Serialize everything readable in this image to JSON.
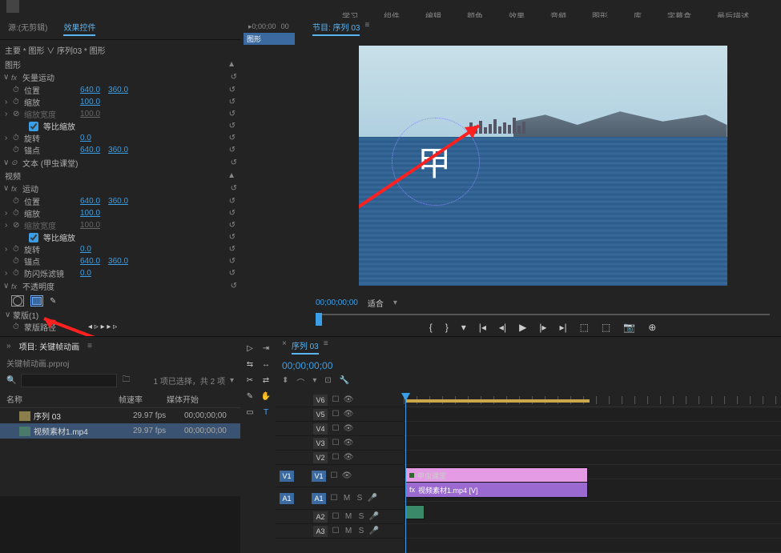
{
  "top_source": "源:(无剪辑)",
  "top_fx": "效果控件",
  "top_menu": [
    "学习",
    "组件",
    "编辑",
    "颜色",
    "效果",
    "音频",
    "图形",
    "库",
    "字幕盒",
    "最后描述"
  ],
  "breadcrumb": "主要 * 图形 ∨ 序列03 * 图形",
  "section_graphic": "图形",
  "seq_time_a": "0;00;00",
  "seq_time_b": "00",
  "seq_clip_label": "图形",
  "fx_vector": "矢量运动",
  "fx_video": "视频",
  "fx_motion": "运动",
  "fx_text": "文本 (甲虫课堂)",
  "fx_position": "位置",
  "fx_scale": "缩放",
  "fx_scale_w": "缩放宽度",
  "fx_uniform": "等比缩放",
  "fx_rotation": "旋转",
  "fx_anchor": "锚点",
  "fx_antiflicker": "防闪烁滤镜",
  "fx_opacity": "不透明度",
  "fx_mask": "蒙版(1)",
  "fx_mask_path": "蒙版路径",
  "val_640": "640.0",
  "val_360": "360.0",
  "val_100": "100.0",
  "val_0": "0.0",
  "project_tab": "项目: 关键帧动画",
  "project_file": "关键帧动画.prproj",
  "proj_info": "1 项已选择，共 2 项",
  "col_name": "名称",
  "col_fps": "帧速率",
  "col_start": "媒体开始",
  "item1_name": "序列 03",
  "item1_fps": "29.97 fps",
  "item1_start": "00;00;00;00",
  "item2_name": "视频素材1.mp4",
  "item2_fps": "29.97 fps",
  "item2_start": "00;00;00;00",
  "program_tab": "节目: 序列 03",
  "monitor_glyph": "甲",
  "monitor_tc": "00;00;00;00",
  "monitor_fit": "适合",
  "timeline_tab": "序列 03",
  "timeline_tc": "00;00;00;00",
  "trk_v6": "V6",
  "trk_v5": "V5",
  "trk_v4": "V4",
  "trk_v3": "V3",
  "trk_v2": "V2",
  "trk_v1": "V1",
  "trk_a1": "A1",
  "trk_a2": "A2",
  "trk_a3": "A3",
  "clip_title1": "甲虫课堂",
  "clip_title2": "视频素材1.mp4 [V]"
}
